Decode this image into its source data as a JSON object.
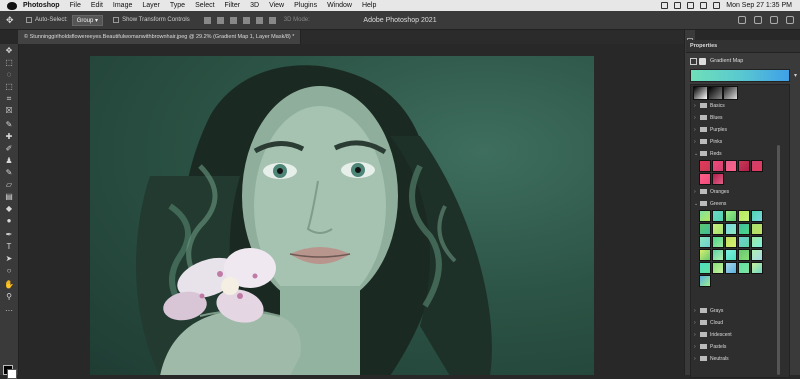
{
  "menubar": {
    "items": [
      "Photoshop",
      "File",
      "Edit",
      "Image",
      "Layer",
      "Type",
      "Select",
      "Filter",
      "3D",
      "View",
      "Plugins",
      "Window",
      "Help"
    ],
    "datetime": "Mon Sep 27  1:35 PM"
  },
  "options": {
    "auto_select_label": "Auto-Select:",
    "auto_select_value": "Group",
    "transform_label": "Show Transform Controls",
    "three_d_label": "3D Mode:",
    "window_title": "Adobe Photoshop 2021"
  },
  "document": {
    "tab_title": "© Stunninggirlholdsflowereeyes.Beautifulwomanwithbrownhair.jpeg @ 29.2% (Gradient Map 1, Layer Mask/8) *"
  },
  "properties": {
    "title": "Properties",
    "layer_type": "Gradient Map",
    "gradient_colors": [
      "#6fe0b8",
      "#5ac9d0",
      "#3fa0e8"
    ],
    "folders": {
      "basics": "Basics",
      "blues": "Blues",
      "purples": "Purples",
      "pinks": "Pinks",
      "reds": "Reds",
      "oranges": "Oranges",
      "greens": "Greens",
      "grays": "Grays",
      "cloud": "Cloud",
      "iridescent": "Iridescent",
      "pastels": "Pastels",
      "neutrals": "Neutrals"
    },
    "reds_swatches": [
      "#e23a5a",
      "#f04a7a",
      "#e0608a",
      "#c83a56",
      "#d0406e",
      "#ff5f8a",
      "#b01e4a"
    ],
    "greens_swatches": [
      "#7fe3a2",
      "#6ed7c4",
      "#9ef08a",
      "#b6e85c",
      "#4fd3b0",
      "#5ec86e",
      "#c6f07a",
      "#7ad7e0",
      "#3fbf9a",
      "#a8e070",
      "#8be8c0",
      "#4ad88a",
      "#c0e060",
      "#6cd0d0",
      "#9fe6a0",
      "#d8f070",
      "#5fd2a8",
      "#7ff0e0",
      "#68c870",
      "#b0f0b0",
      "#4ee0c0",
      "#88e078",
      "#a8d8e8",
      "#60e0a0",
      "#c8f0a0",
      "#5ab0e0"
    ]
  }
}
